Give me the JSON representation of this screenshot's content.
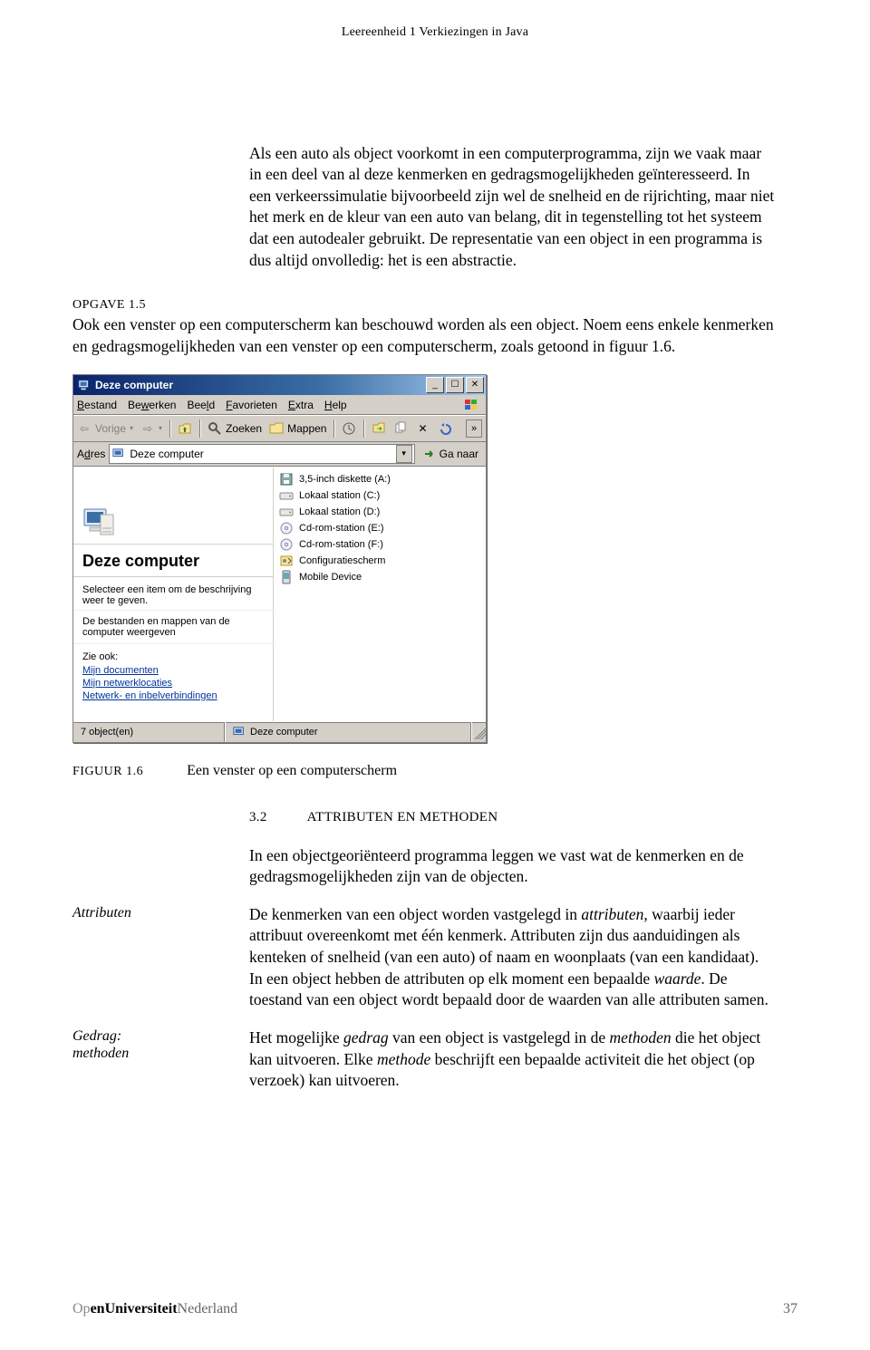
{
  "header": {
    "running": "Leereenheid 1    Verkiezingen in Java"
  },
  "intro_para": "Als een auto als object voorkomt in een computerprogramma, zijn we vaak maar in een deel van al deze kenmerken en gedragsmogelijkheden geïnteresseerd. In een verkeerssimulatie bijvoorbeeld zijn wel de snelheid en de rijrichting, maar niet het merk en de kleur van een auto van belang, dit in tegenstelling tot het systeem dat een autodealer gebruikt. De representatie van een object in een programma is dus altijd onvolledig: het is een abstractie.",
  "opgave": {
    "label": "OPGAVE  1.5",
    "text": "Ook een venster op een computerscherm kan beschouwd worden als een object. Noem eens enkele kenmerken en gedragsmogelijkheden van een venster op een computerscherm, zoals getoond in figuur 1.6."
  },
  "win": {
    "title": "Deze computer",
    "menus": {
      "bestand": "Bestand",
      "bewerken": "Bewerken",
      "beeld": "Beeld",
      "favorieten": "Favorieten",
      "extra": "Extra",
      "help": "Help"
    },
    "toolbar": {
      "back": "Vorige",
      "zoeken": "Zoeken",
      "mappen": "Mappen"
    },
    "addr": {
      "label": "Adres",
      "value": "Deze computer",
      "go": "Ga naar"
    },
    "left": {
      "title": "Deze computer",
      "hint": "Selecteer een item om de beschrijving weer te geven.",
      "hint2": "De bestanden en mappen van de computer weergeven",
      "see": "Zie ook:",
      "links": [
        "Mijn documenten",
        "Mijn netwerklocaties",
        "Netwerk- en inbelverbindingen"
      ]
    },
    "items": [
      "3,5-inch diskette (A:)",
      "Lokaal station (C:)",
      "Lokaal station (D:)",
      "Cd-rom-station (E:)",
      "Cd-rom-station (F:)",
      "Configuratiescherm",
      "Mobile Device"
    ],
    "status": {
      "left": "7 object(en)",
      "mid": "Deze computer"
    }
  },
  "figure": {
    "label": "FIGUUR  1.6",
    "caption": "Een venster op een computerscherm"
  },
  "section": {
    "num": "3.2",
    "title": "ATTRIBUTEN EN METHODEN"
  },
  "body": {
    "p1": "In een objectgeoriënteerd programma leggen we vast wat de kenmerken en de gedragsmogelijkheden zijn van de objecten.",
    "p2_pre": "De kenmerken van een object worden vastgelegd in ",
    "p2_t1": "attributen",
    "p2_mid": ", waarbij ieder attribuut overeenkomt met één kenmerk. Attributen zijn dus aanduidingen als kenteken of snelheid (van een auto) of naam en woonplaats (van een kandidaat). In een object hebben de attributen op elk moment een bepaalde ",
    "p2_t2": "waarde",
    "p2_post": ". De toestand van een object wordt bepaald door de waarden van alle attributen samen.",
    "p3_pre": "Het mogelijke ",
    "p3_t1": "gedrag",
    "p3_mid": " van een object is vastgelegd in de ",
    "p3_t2": "methoden",
    "p3_mid2": " die het object kan uitvoeren. Elke ",
    "p3_t3": "methode",
    "p3_post": " beschrijft een bepaalde activiteit die het object (op verzoek) kan uitvoeren."
  },
  "margins": {
    "m1": "Attributen",
    "m2a": "Gedrag:",
    "m2b": "methoden"
  },
  "footer": {
    "b0": "Op",
    "b1": "enUniversiteit",
    "b2": "Nederland",
    "page": "37"
  }
}
